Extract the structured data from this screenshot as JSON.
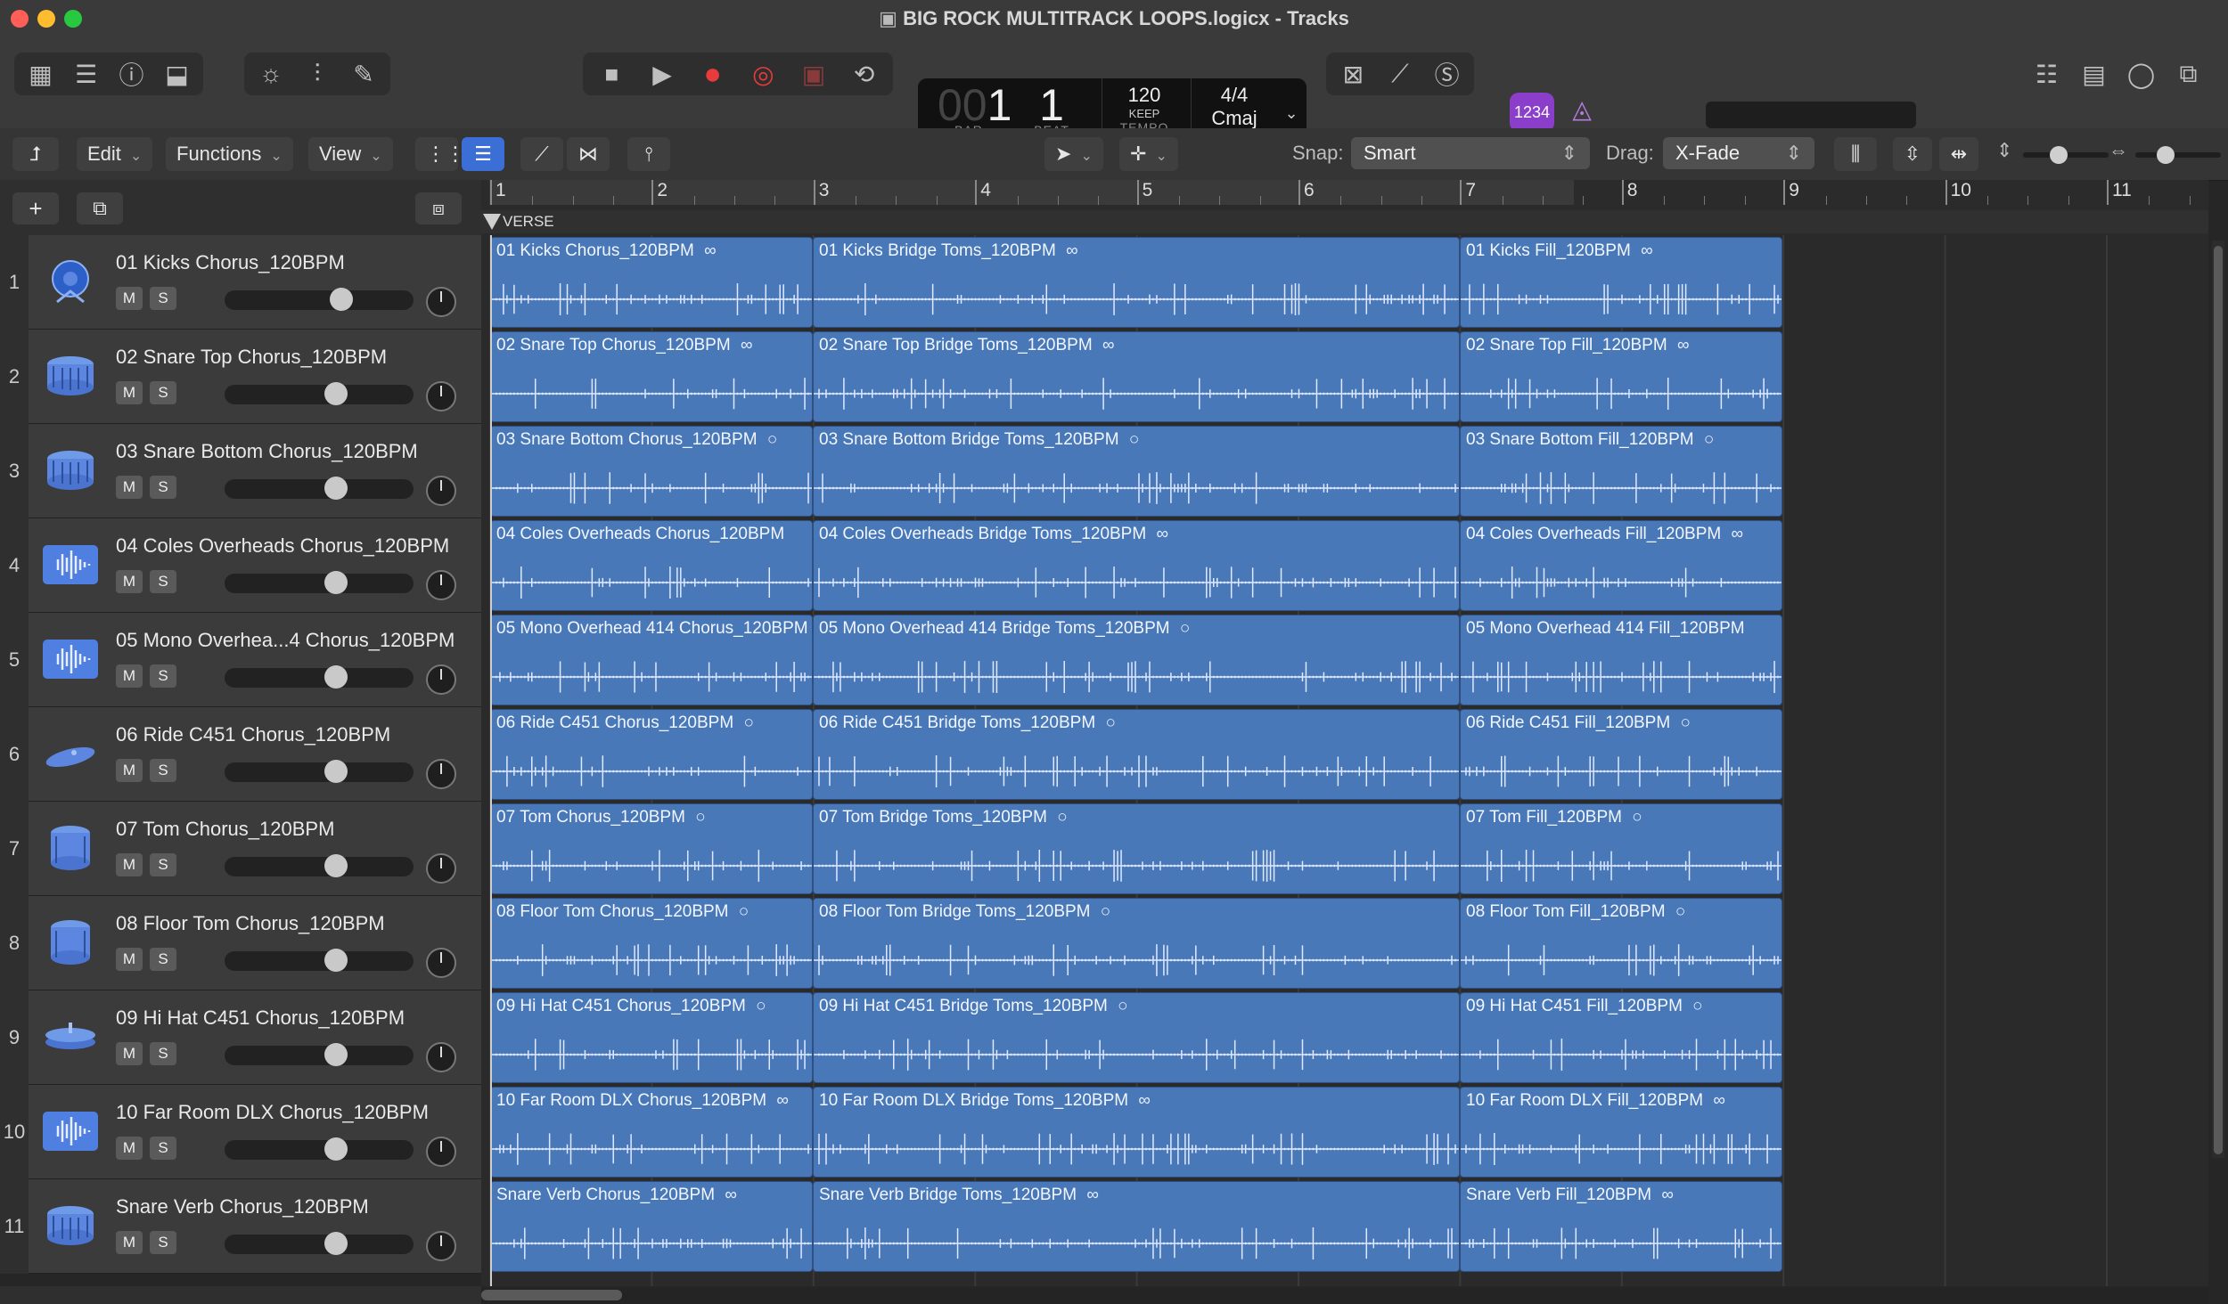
{
  "window": {
    "title": "BIG ROCK MULTITRACK LOOPS.logicx - Tracks",
    "colors": {
      "close": "#ff5f57",
      "minimize": "#febc2e",
      "zoom": "#28c840"
    }
  },
  "lcd": {
    "bar": "1",
    "beat": "1",
    "bar_label": "BAR",
    "beat_label": "BEAT",
    "tempo": "120",
    "tempo_mode": "KEEP",
    "tempo_label": "TEMPO",
    "signature": "4/4",
    "key": "Cmaj",
    "count_in": "1234"
  },
  "toolbar": {
    "edit": "Edit",
    "functions": "Functions",
    "view": "View",
    "snap_label": "Snap:",
    "snap_value": "Smart",
    "drag_label": "Drag:",
    "drag_value": "X-Fade"
  },
  "ruler": {
    "bars": [
      "1",
      "2",
      "3",
      "4",
      "5",
      "6",
      "7",
      "8",
      "9",
      "10",
      "11"
    ],
    "marker": "VERSE"
  },
  "colors": {
    "region": "#4978b8",
    "accent": "#5c7fe0",
    "count_in": "#8a3ec9"
  },
  "tracks": [
    {
      "num": "1",
      "name": "01 Kicks Chorus_120BPM",
      "icon": "kick-drum-icon",
      "mute": "M",
      "solo": "S",
      "regions": [
        {
          "name": "01 Kicks Chorus_120BPM",
          "icon": "∞"
        },
        {
          "name": "01 Kicks Bridge Toms_120BPM",
          "icon": "∞"
        },
        {
          "name": "01 Kicks Fill_120BPM",
          "icon": "∞"
        }
      ]
    },
    {
      "num": "2",
      "name": "02 Snare Top Chorus_120BPM",
      "icon": "snare-drum-icon",
      "mute": "M",
      "solo": "S",
      "regions": [
        {
          "name": "02 Snare Top Chorus_120BPM",
          "icon": "∞"
        },
        {
          "name": "02 Snare Top Bridge Toms_120BPM",
          "icon": "∞"
        },
        {
          "name": "02 Snare Top Fill_120BPM",
          "icon": "∞"
        }
      ]
    },
    {
      "num": "3",
      "name": "03 Snare Bottom Chorus_120BPM",
      "icon": "snare-drum-icon",
      "mute": "M",
      "solo": "S",
      "regions": [
        {
          "name": "03 Snare Bottom Chorus_120BPM",
          "icon": "○"
        },
        {
          "name": "03 Snare Bottom Bridge Toms_120BPM",
          "icon": "○"
        },
        {
          "name": "03 Snare Bottom Fill_120BPM",
          "icon": "○"
        }
      ]
    },
    {
      "num": "4",
      "name": "04 Coles Overheads Chorus_120BPM",
      "icon": "waveform-icon",
      "mute": "M",
      "solo": "S",
      "regions": [
        {
          "name": "04 Coles Overheads Chorus_120BPM",
          "icon": ""
        },
        {
          "name": "04 Coles Overheads Bridge Toms_120BPM",
          "icon": "∞"
        },
        {
          "name": "04 Coles Overheads Fill_120BPM",
          "icon": "∞"
        }
      ]
    },
    {
      "num": "5",
      "name": "05 Mono Overhea...4 Chorus_120BPM",
      "icon": "waveform-icon",
      "mute": "M",
      "solo": "S",
      "regions": [
        {
          "name": "05 Mono Overhead 414 Chorus_120BPM",
          "icon": ""
        },
        {
          "name": "05 Mono Overhead 414 Bridge Toms_120BPM",
          "icon": "○"
        },
        {
          "name": "05 Mono Overhead 414 Fill_120BPM",
          "icon": ""
        }
      ]
    },
    {
      "num": "6",
      "name": "06 Ride C451 Chorus_120BPM",
      "icon": "cymbal-icon",
      "mute": "M",
      "solo": "S",
      "regions": [
        {
          "name": "06 Ride C451 Chorus_120BPM",
          "icon": "○"
        },
        {
          "name": "06 Ride C451 Bridge Toms_120BPM",
          "icon": "○"
        },
        {
          "name": "06 Ride C451 Fill_120BPM",
          "icon": "○"
        }
      ]
    },
    {
      "num": "7",
      "name": "07 Tom Chorus_120BPM",
      "icon": "tom-drum-icon",
      "mute": "M",
      "solo": "S",
      "regions": [
        {
          "name": "07 Tom Chorus_120BPM",
          "icon": "○"
        },
        {
          "name": "07 Tom Bridge Toms_120BPM",
          "icon": "○"
        },
        {
          "name": "07 Tom Fill_120BPM",
          "icon": "○"
        }
      ]
    },
    {
      "num": "8",
      "name": "08 Floor Tom Chorus_120BPM",
      "icon": "tom-drum-icon",
      "mute": "M",
      "solo": "S",
      "regions": [
        {
          "name": "08 Floor Tom Chorus_120BPM",
          "icon": "○"
        },
        {
          "name": "08 Floor Tom Bridge Toms_120BPM",
          "icon": "○"
        },
        {
          "name": "08 Floor Tom Fill_120BPM",
          "icon": "○"
        }
      ]
    },
    {
      "num": "9",
      "name": "09 Hi Hat C451 Chorus_120BPM",
      "icon": "hihat-icon",
      "mute": "M",
      "solo": "S",
      "regions": [
        {
          "name": "09 Hi Hat C451 Chorus_120BPM",
          "icon": "○"
        },
        {
          "name": "09 Hi Hat C451 Bridge Toms_120BPM",
          "icon": "○"
        },
        {
          "name": "09 Hi Hat C451 Fill_120BPM",
          "icon": "○"
        }
      ]
    },
    {
      "num": "10",
      "name": "10 Far Room DLX Chorus_120BPM",
      "icon": "waveform-icon",
      "mute": "M",
      "solo": "S",
      "regions": [
        {
          "name": "10 Far Room DLX Chorus_120BPM",
          "icon": "∞"
        },
        {
          "name": "10 Far Room DLX Bridge Toms_120BPM",
          "icon": "∞"
        },
        {
          "name": "10 Far Room DLX Fill_120BPM",
          "icon": "∞"
        }
      ]
    },
    {
      "num": "11",
      "name": "Snare Verb Chorus_120BPM",
      "icon": "snare-drum-icon",
      "mute": "M",
      "solo": "S",
      "regions": [
        {
          "name": "Snare Verb Chorus_120BPM",
          "icon": "∞"
        },
        {
          "name": "Snare Verb Bridge Toms_120BPM",
          "icon": "∞"
        },
        {
          "name": "Snare Verb Fill_120BPM",
          "icon": "∞"
        }
      ]
    }
  ]
}
